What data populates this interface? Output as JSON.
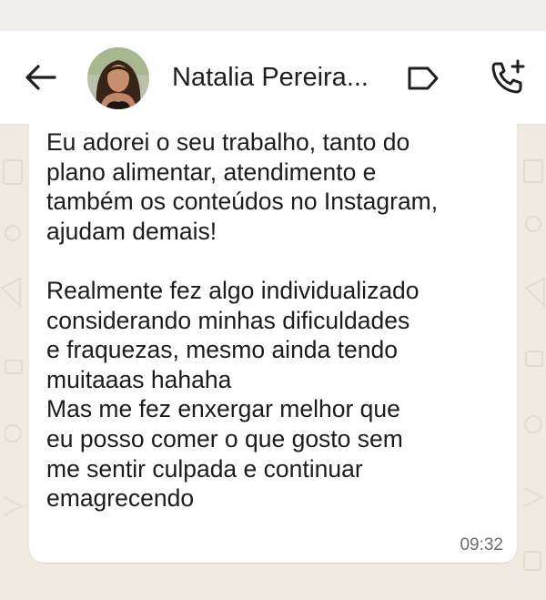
{
  "header": {
    "contact_name": "Natalia Pereira...",
    "icons": {
      "back": "arrow-left-icon",
      "label": "label-tag-icon",
      "call": "add-call-icon"
    }
  },
  "message": {
    "text": "Eu adorei o seu trabalho, tanto do\nplano alimentar, atendimento e\ntambém os conteúdos no Instagram,\najudam demais!\n\nRealmente fez algo individualizado\nconsiderando minhas dificuldades\ne fraquezas, mesmo ainda tendo\nmuitaaas hahaha\nMas me fez enxergar melhor que\neu posso comer o que gosto sem\nme sentir culpada e continuar\nemagrecendo",
    "time": "09:32"
  },
  "colors": {
    "header_bg": "#ffffff",
    "chat_bg": "#efeae2",
    "bubble_bg": "#ffffff",
    "text": "#1c1c1c",
    "time": "#6d6d6d"
  }
}
